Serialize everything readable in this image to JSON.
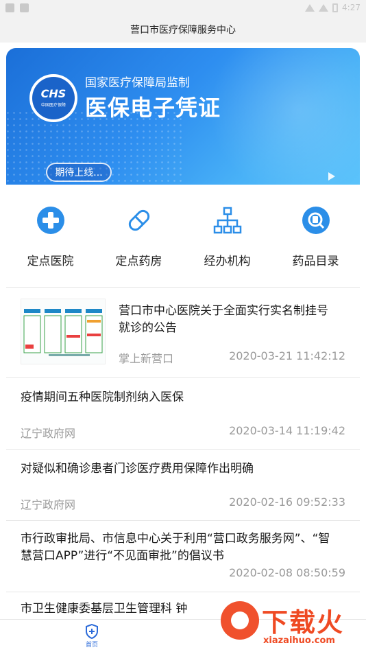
{
  "status_bar": {
    "time": "4:27"
  },
  "app_bar": {
    "title": "营口市医疗保障服务中心"
  },
  "banner": {
    "logo_text": "CHS",
    "logo_subtext": "中国医疗保障",
    "subtitle": "国家医疗保障局监制",
    "title": "医保电子凭证",
    "pill": "期待上线..."
  },
  "quick_actions": [
    {
      "label": "定点医院",
      "icon": "plus-circle-icon"
    },
    {
      "label": "定点药房",
      "icon": "pill-capsule-icon"
    },
    {
      "label": "经办机构",
      "icon": "org-chart-icon"
    },
    {
      "label": "药品目录",
      "icon": "search-document-icon"
    }
  ],
  "news": [
    {
      "title": "营口市中心医院关于全面实行实名制挂号就诊的公告",
      "source": "掌上新营口",
      "date": "2020-03-21 11:42:12",
      "has_thumb": true
    },
    {
      "title": "疫情期间五种医院制剂纳入医保",
      "source": "辽宁政府网",
      "date": "2020-03-14 11:19:42"
    },
    {
      "title": "对疑似和确诊患者门诊医疗费用保障作出明确",
      "source": "辽宁政府网",
      "date": "2020-02-16 09:52:33"
    },
    {
      "title": "市行政审批局、市信息中心关于利用“营口政务服务网”、“智慧营口APP”进行“不见面审批”的倡议书",
      "source": "",
      "date": "2020-02-08 08:50:59"
    },
    {
      "title": "市卫生健康委基层卫生管理科 钟"
    }
  ],
  "bottom_nav": {
    "home_label": "首页"
  },
  "watermark": {
    "text": "下载火",
    "url": "xiazaihuo.com"
  },
  "colors": {
    "accent": "#2b6ad9",
    "banner": "#2e8ef0",
    "watermark": "#ef4a23"
  }
}
